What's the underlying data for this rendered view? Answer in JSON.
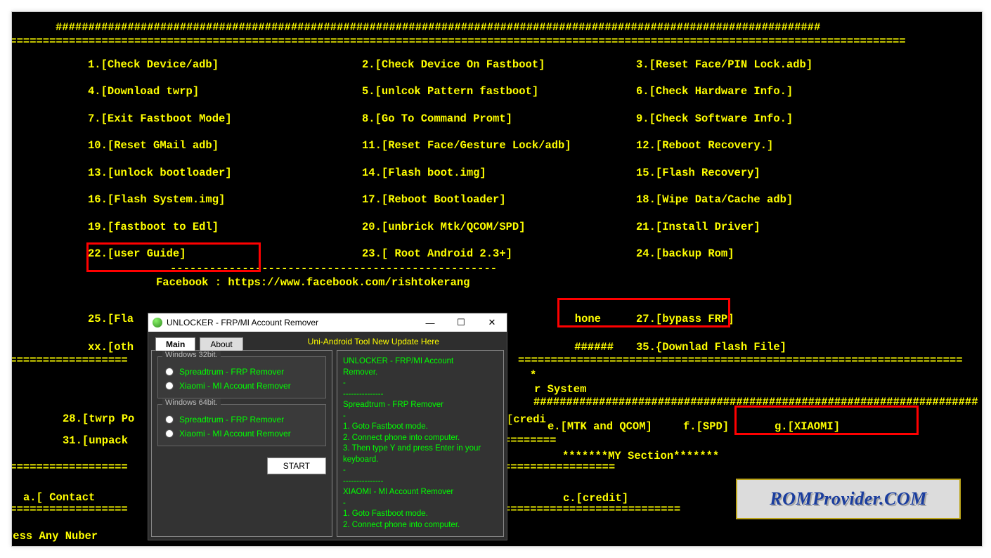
{
  "sep": {
    "hash_long": "#####################################################################################################################",
    "hash_mid": "##########################",
    "eq_long": "=========================================================================================================================================="
  },
  "menu": {
    "r1": {
      "a": "1.[Check Device/adb]",
      "b": "2.[Check Device On Fastboot]",
      "c": "3.[Reset Face/PIN Lock.adb]"
    },
    "r2": {
      "a": "4.[Download twrp]",
      "b": "5.[unlcok Pattern fastboot]",
      "c": "6.[Check Hardware Info.]"
    },
    "r3": {
      "a": "7.[Exit Fastboot Mode]",
      "b": "8.[Go To Command Promt]",
      "c": "9.[Check Software Info.]"
    },
    "r4": {
      "a": "10.[Reset GMail adb]",
      "b": "11.[Reset Face/Gesture Lock/adb]",
      "c": "12.[Reboot Recovery.]"
    },
    "r5": {
      "a": "13.[unlock bootloader]",
      "b": "14.[Flash boot.img]",
      "c": "15.[Flash Recovery]"
    },
    "r6": {
      "a": "16.[Flash System.img]",
      "b": "17.[Reboot Bootloader]",
      "c": "18.[Wipe Data/Cache adb]"
    },
    "r7": {
      "a": "19.[fastboot to Edl]",
      "b": "20.[unbrick Mtk/QCOM/SPD]",
      "c": "21.[Install Driver]"
    },
    "r8": {
      "a": "22.[user Guide]",
      "b": "23.[ Root Android 2.3+]",
      "c": "24.[backup Rom]"
    },
    "r9": {
      "a": "25.[Fla",
      "b_tail": "hone",
      "c": "27.[bypass FRP]"
    },
    "r10": {
      "a": "xx.[oth",
      "b_tail": "######",
      "c": "35.{Downlad Flash File]"
    }
  },
  "facebook": "Facebook : https://www.facebook.com/rishtokerang",
  "lower": {
    "star": "*",
    "rsys": "r System",
    "l28": "28.[twrp Po",
    "l31": "31.[unpack",
    "credi": "[credi",
    "e": "e.[MTK and QCOM]",
    "f": "f.[SPD]",
    "g": "g.[XIAOMI]",
    "my_section": "*******MY Section*******",
    "a_cont": "a.[ Contact",
    "c_credit": "c.[credit]",
    "press": "ress Any Nuber"
  },
  "win": {
    "title": "UNLOCKER - FRP/MI Account Remover",
    "banner": "Uni-Android Tool New Update Here",
    "tabs": {
      "main": "Main",
      "about": "About"
    },
    "g32": "Windows 32bit.",
    "g64": "Windows 64bit.",
    "opt_spd": "Spreadtrum - FRP Remover",
    "opt_mi": "Xiaomi - MI Account Remover",
    "start": "START",
    "mini": "—",
    "maxi": "☐",
    "close": "✕",
    "log": {
      "l1": "UNLOCKER - FRP/MI Account",
      "l2": "Remover.",
      "dash": "---------------",
      "l3": "Spreadtrum - FRP Remover",
      "l4": "1. Goto Fastboot mode.",
      "l5": "2. Connect phone into computer.",
      "l6": "3. Then type Y and press Enter in your",
      "l7": "keyboard.",
      "l8": "XIAOMI - MI Account Remover",
      "l9": "1. Goto Fastboot mode.",
      "l10": "2. Connect phone into computer."
    }
  },
  "logo": "ROMProvider.COM"
}
